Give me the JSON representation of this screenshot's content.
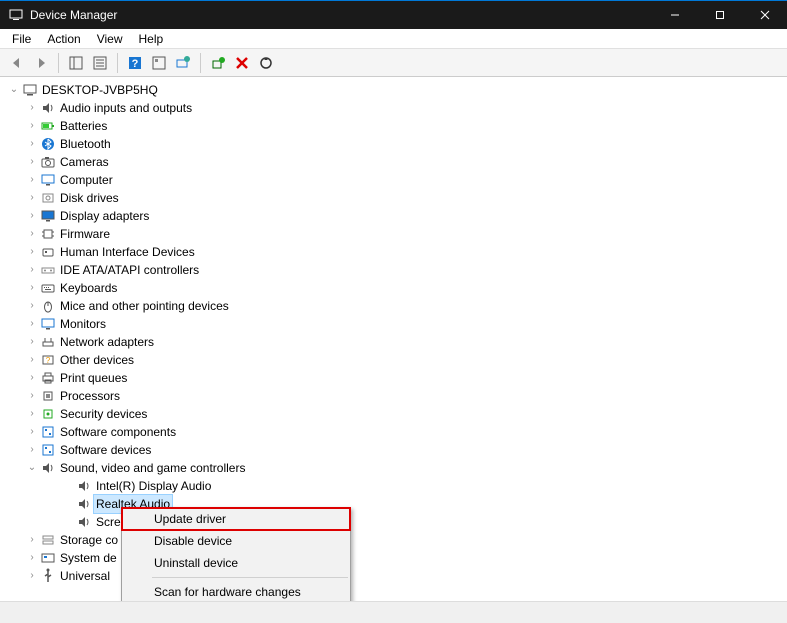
{
  "window": {
    "title": "Device Manager",
    "controls": {
      "minimize": "−",
      "maximize": "▢",
      "close": "✕"
    }
  },
  "menubar": [
    "File",
    "Action",
    "View",
    "Help"
  ],
  "toolbar": {
    "back": "back-icon",
    "forward": "forward-icon",
    "show_tree": "show-tree-icon",
    "properties": "properties-icon",
    "help": "help-icon",
    "show_hidden": "show-hidden-icon",
    "scan": "scan-icon",
    "add_legacy": "add-legacy-icon",
    "remove": "remove-icon",
    "update": "update-icon"
  },
  "root": {
    "label": "DESKTOP-JVBP5HQ",
    "expanded": true
  },
  "categories": [
    {
      "label": "Audio inputs and outputs",
      "icon": "speaker-icon",
      "expanded": false
    },
    {
      "label": "Batteries",
      "icon": "battery-icon",
      "expanded": false
    },
    {
      "label": "Bluetooth",
      "icon": "bluetooth-icon",
      "expanded": false
    },
    {
      "label": "Cameras",
      "icon": "camera-icon",
      "expanded": false
    },
    {
      "label": "Computer",
      "icon": "monitor-icon",
      "expanded": false
    },
    {
      "label": "Disk drives",
      "icon": "disk-icon",
      "expanded": false
    },
    {
      "label": "Display adapters",
      "icon": "display-icon",
      "expanded": false
    },
    {
      "label": "Firmware",
      "icon": "chip-icon",
      "expanded": false
    },
    {
      "label": "Human Interface Devices",
      "icon": "hid-icon",
      "expanded": false
    },
    {
      "label": "IDE ATA/ATAPI controllers",
      "icon": "ide-icon",
      "expanded": false
    },
    {
      "label": "Keyboards",
      "icon": "keyboard-icon",
      "expanded": false
    },
    {
      "label": "Mice and other pointing devices",
      "icon": "mouse-icon",
      "expanded": false
    },
    {
      "label": "Monitors",
      "icon": "monitor-icon",
      "expanded": false
    },
    {
      "label": "Network adapters",
      "icon": "network-icon",
      "expanded": false
    },
    {
      "label": "Other devices",
      "icon": "other-icon",
      "expanded": false
    },
    {
      "label": "Print queues",
      "icon": "printer-icon",
      "expanded": false
    },
    {
      "label": "Processors",
      "icon": "cpu-icon",
      "expanded": false
    },
    {
      "label": "Security devices",
      "icon": "security-icon",
      "expanded": false
    },
    {
      "label": "Software components",
      "icon": "software-icon",
      "expanded": false
    },
    {
      "label": "Software devices",
      "icon": "software-icon",
      "expanded": false
    },
    {
      "label": "Sound, video and game controllers",
      "icon": "speaker-icon",
      "expanded": true,
      "children": [
        {
          "label": "Intel(R) Display Audio",
          "icon": "speaker-icon"
        },
        {
          "label": "Realtek Audio",
          "icon": "speaker-icon",
          "selected": true
        },
        {
          "label": "Scream",
          "icon": "speaker-icon",
          "truncated": "Screa"
        }
      ]
    },
    {
      "label": "Storage controllers",
      "icon": "storage-icon",
      "expanded": false,
      "truncated": "Storage co"
    },
    {
      "label": "System devices",
      "icon": "system-icon",
      "expanded": false,
      "truncated": "System de"
    },
    {
      "label": "Universal Serial Bus controllers",
      "icon": "usb-icon",
      "expanded": false,
      "truncated": "Universal "
    }
  ],
  "context_menu": {
    "items": [
      {
        "label": "Update driver",
        "highlight": true
      },
      {
        "label": "Disable device"
      },
      {
        "label": "Uninstall device"
      },
      {
        "separator": true
      },
      {
        "label": "Scan for hardware changes"
      }
    ]
  }
}
